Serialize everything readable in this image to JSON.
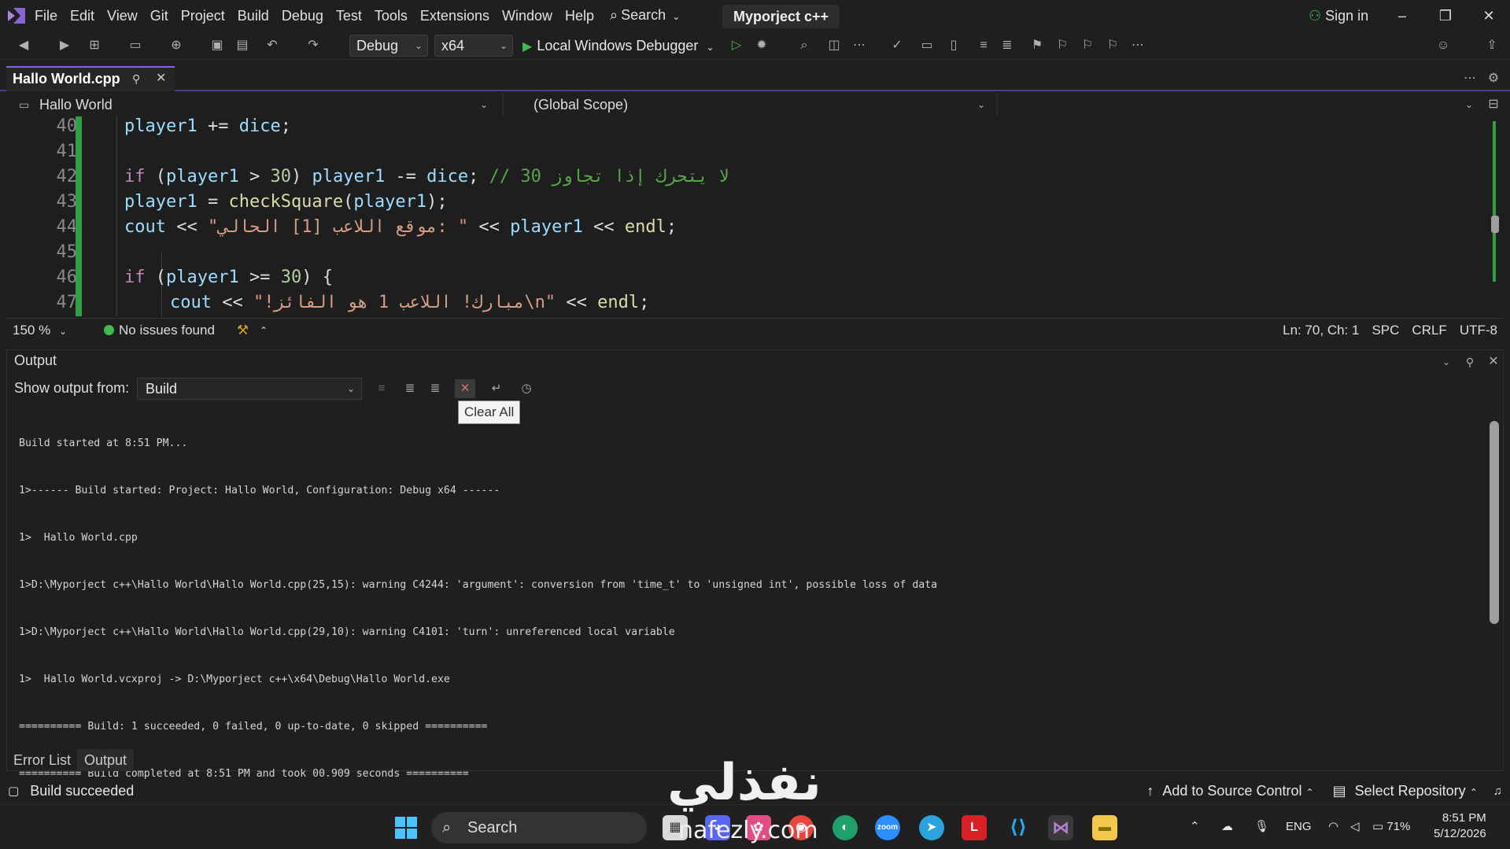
{
  "titlebar": {
    "menu": [
      "File",
      "Edit",
      "View",
      "Git",
      "Project",
      "Build",
      "Debug",
      "Test",
      "Tools",
      "Extensions",
      "Window",
      "Help"
    ],
    "search_label": "Search",
    "project_name": "Myporject c++",
    "sign_in": "Sign in"
  },
  "toolbar": {
    "configuration": "Debug",
    "platform": "x64",
    "debugger": "Local Windows Debugger"
  },
  "tab": {
    "file_name": "Hallo World.cpp"
  },
  "navbar": {
    "project": "Hallo World",
    "scope": "(Global Scope)"
  },
  "editor": {
    "lines": [
      {
        "n": "40",
        "code": "player1 += dice;"
      },
      {
        "n": "41",
        "code": ""
      },
      {
        "n": "42",
        "code": "if (player1 > 30) player1 -= dice; // لا يتحرك إذا تجاوز 30"
      },
      {
        "n": "43",
        "code": "player1 = checkSquare(player1);"
      },
      {
        "n": "44",
        "code": "cout << \"موقع اللاعب [1] الحالي: \" << player1 << endl;"
      },
      {
        "n": "45",
        "code": ""
      },
      {
        "n": "46",
        "code": "if (player1 >= 30) {"
      },
      {
        "n": "47",
        "code": "cout << \"!مبارك! اللاعب 1 هو الفائز\\n\" << endl;"
      }
    ],
    "comment_42": "// لا يتحرك إذا تجاوز 30",
    "string_44": "\"موقع اللاعب [1] الحالي: \"",
    "string_47": "\"!مبارك! اللاعب 1 هو الفائز\\n\""
  },
  "editor_status": {
    "zoom": "150 %",
    "issues": "No issues found",
    "position": "Ln: 70, Ch: 1",
    "whitespace": "SPC",
    "line_ending": "CRLF",
    "encoding": "UTF-8"
  },
  "output": {
    "title": "Output",
    "show_from_label": "Show output from:",
    "source": "Build",
    "tooltip": "Clear All",
    "lines": [
      "Build started at 8:51 PM...",
      "1>------ Build started: Project: Hallo World, Configuration: Debug x64 ------",
      "1>  Hallo World.cpp",
      "1>D:\\Myporject c++\\Hallo World\\Hallo World.cpp(25,15): warning C4244: 'argument': conversion from 'time_t' to 'unsigned int', possible loss of data",
      "1>D:\\Myporject c++\\Hallo World\\Hallo World.cpp(29,10): warning C4101: 'turn': unreferenced local variable",
      "1>  Hallo World.vcxproj -> D:\\Myporject c++\\x64\\Debug\\Hallo World.exe",
      "========== Build: 1 succeeded, 0 failed, 0 up-to-date, 0 skipped ==========",
      "========== Build completed at 8:51 PM and took 00.909 seconds =========="
    ]
  },
  "bottom_tabs": {
    "error_list": "Error List",
    "output": "Output"
  },
  "statusbar": {
    "message": "Build succeeded",
    "source_control": "Add to Source Control",
    "repository": "Select Repository"
  },
  "watermark": {
    "arabic": "نفذلي",
    "latin": "nafezly.com"
  },
  "taskbar": {
    "search": "Search",
    "language": "ENG",
    "battery": "71%",
    "time": "8:51 PM",
    "date": "5/12/2026"
  },
  "colors": {
    "accent": "#8a63d2",
    "success": "#3fb950",
    "keyword": "#c586c0",
    "variable": "#9cdcfe",
    "function": "#dcdcaa",
    "string": "#d69d85",
    "comment": "#57a64a"
  }
}
